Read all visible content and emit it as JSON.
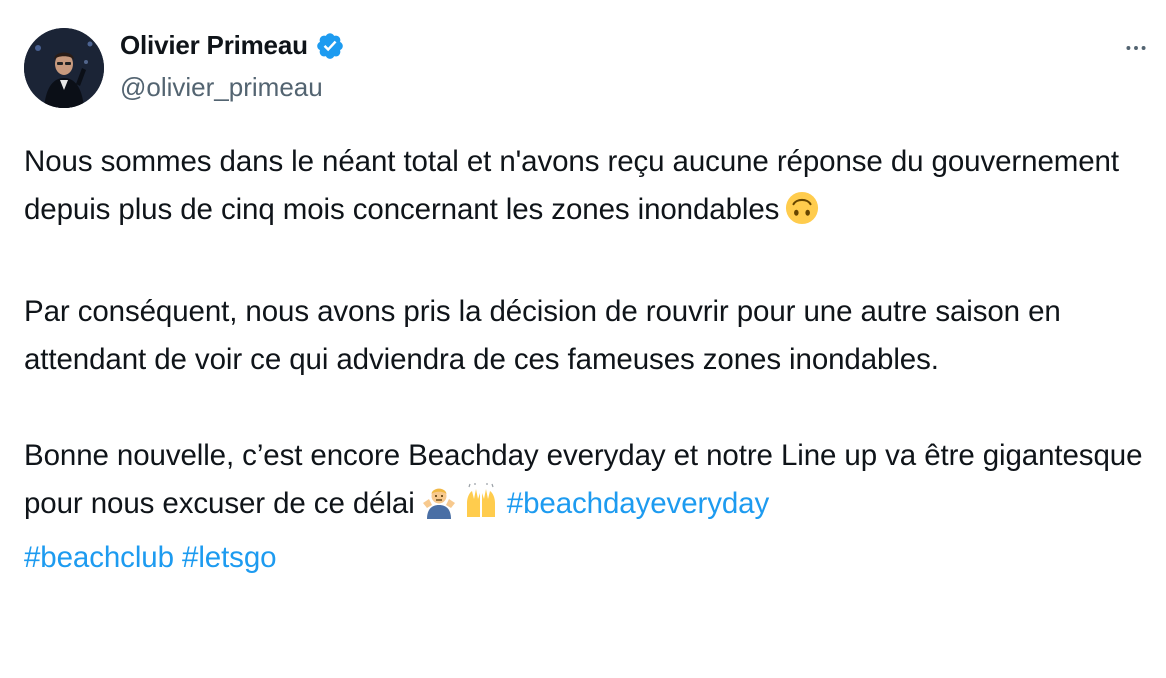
{
  "author": {
    "display_name": "Olivier Primeau",
    "handle": "@olivier_primeau",
    "verified": true,
    "verified_color": "#1d9bf0"
  },
  "more_icon": "more-horizontal-icon",
  "tweet": {
    "para1": "Nous sommes dans le néant total et n'avons reçu aucune réponse du gouvernement depuis plus de cinq mois concernant les zones inondables",
    "para1_emoji": "upside-down-face",
    "para2": "Par conséquent, nous avons pris la décision de rouvrir pour une autre saison en attendant de voir ce qui adviendra de ces fameuses zones inondables.",
    "para3": "Bonne nouvelle, c’est encore Beachday everyday et notre Line up va être gigantesque pour nous excuser de ce délai",
    "para3_emojis": [
      "man-shrugging",
      "raising-hands"
    ],
    "hashtags": [
      "#beachdayeveryday",
      "#beachclub",
      "#letsgo"
    ]
  },
  "colors": {
    "text": "#0f1419",
    "secondary": "#536471",
    "link": "#1d9bf0"
  }
}
